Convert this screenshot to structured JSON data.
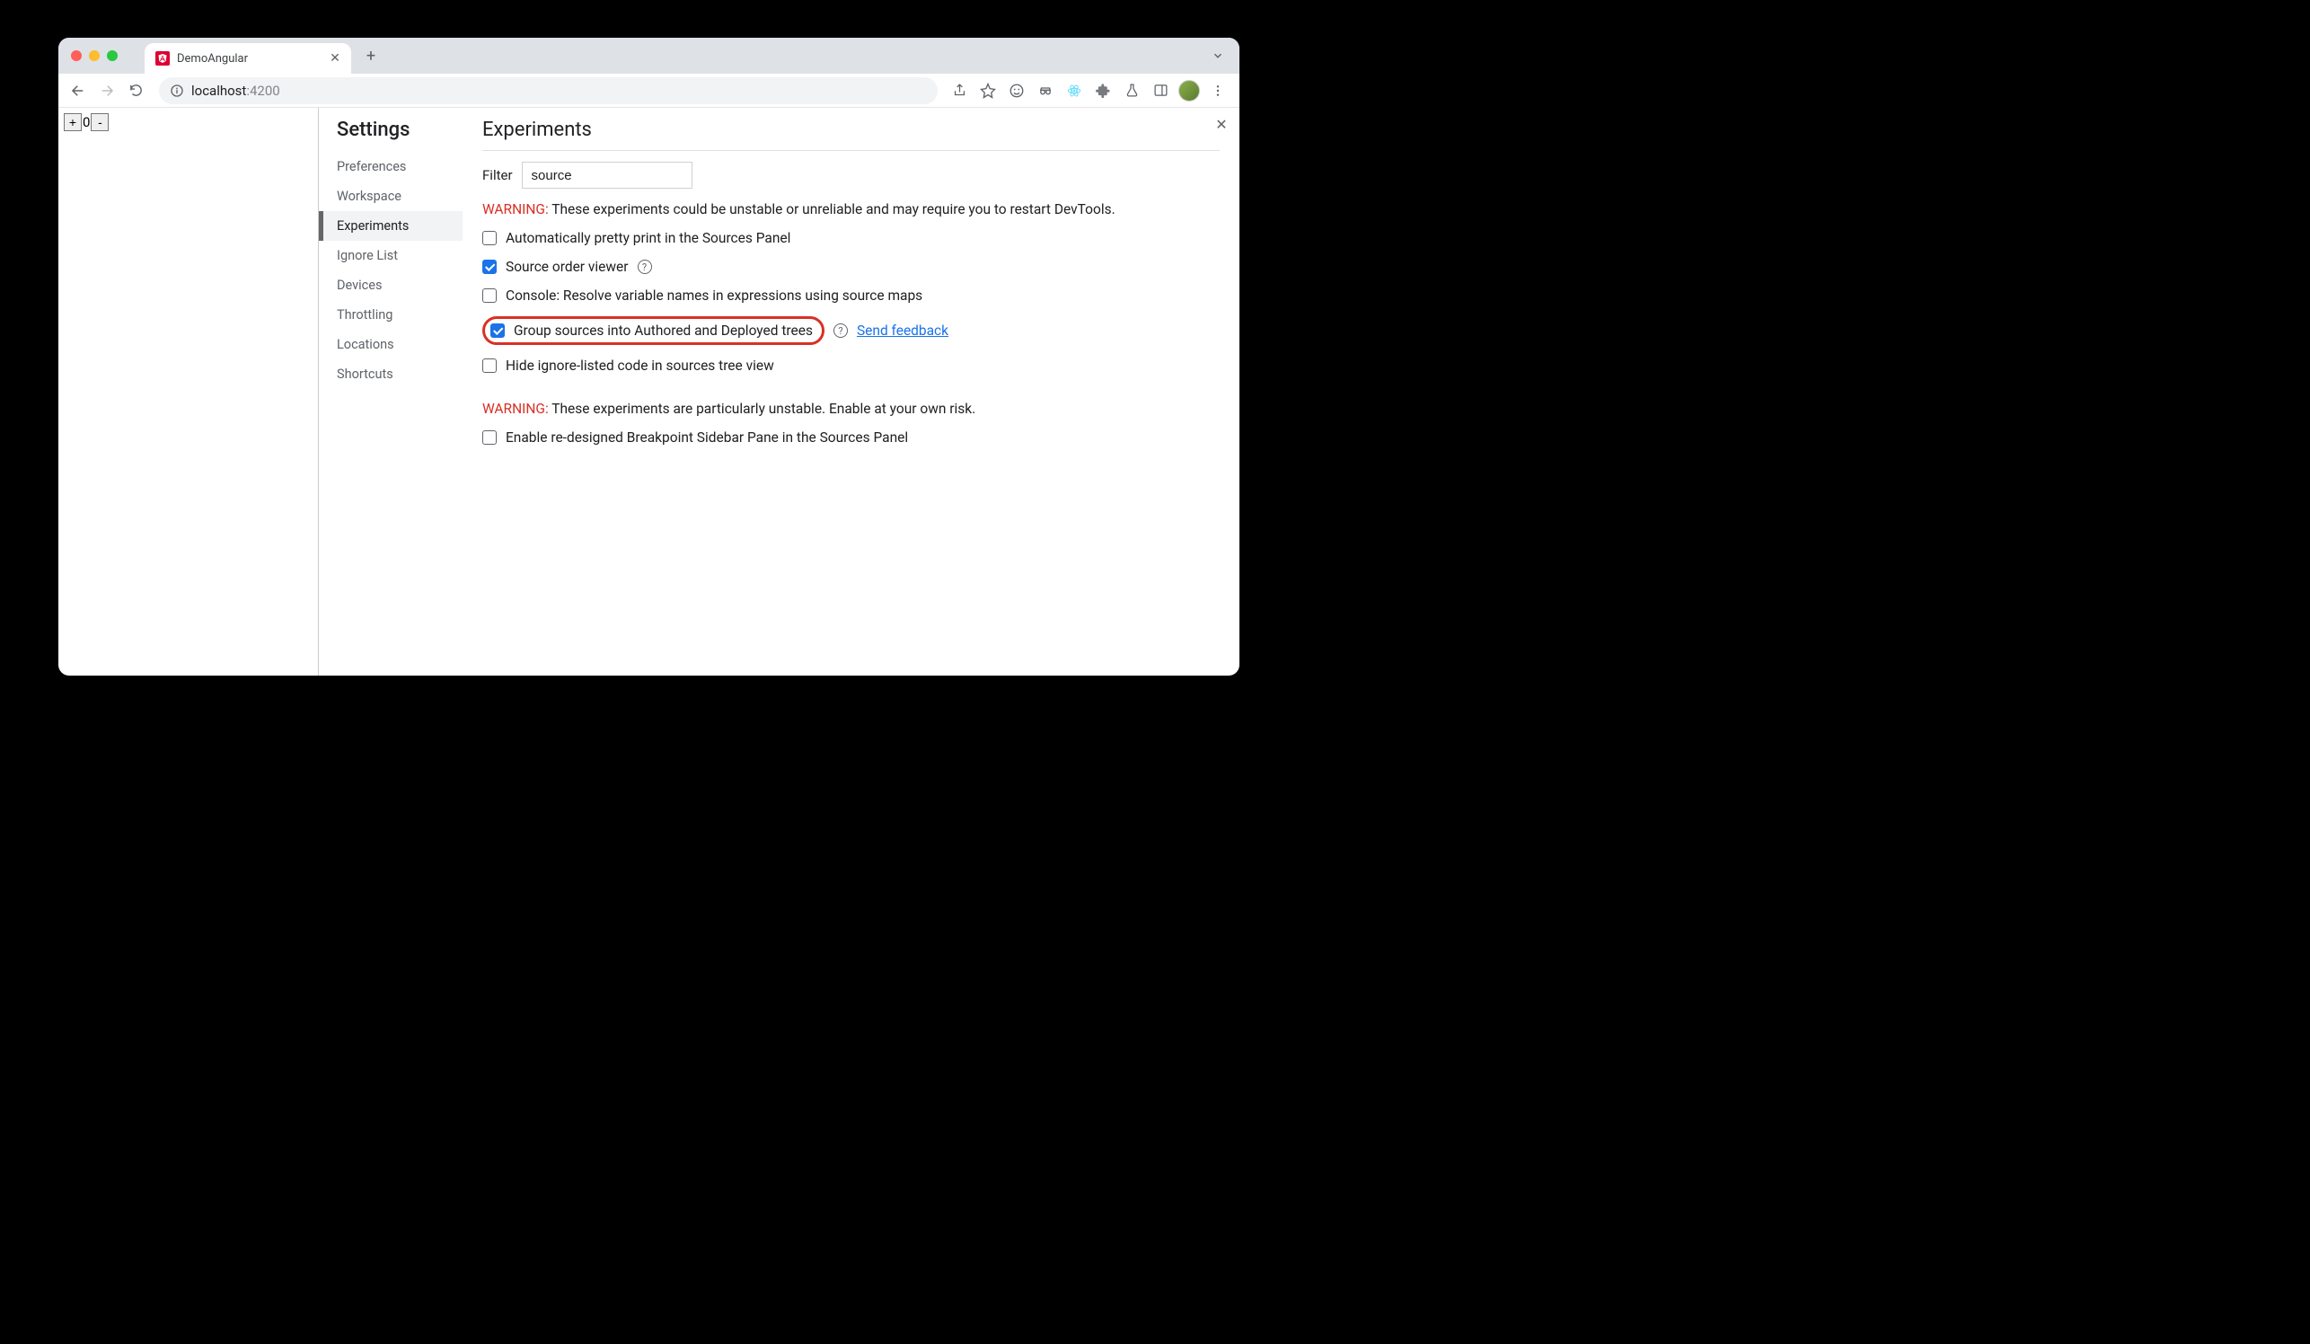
{
  "tab": {
    "title": "DemoAngular"
  },
  "url": {
    "host": "localhost",
    "port": ":4200"
  },
  "page": {
    "counter_value": "0",
    "plus": "+",
    "minus": "-"
  },
  "settings": {
    "title": "Settings",
    "nav": {
      "preferences": "Preferences",
      "workspace": "Workspace",
      "experiments": "Experiments",
      "ignorelist": "Ignore List",
      "devices": "Devices",
      "throttling": "Throttling",
      "locations": "Locations",
      "shortcuts": "Shortcuts"
    }
  },
  "experiments": {
    "title": "Experiments",
    "filter_label": "Filter",
    "filter_value": "source",
    "warning1_label": "WARNING:",
    "warning1_text": " These experiments could be unstable or unreliable and may require you to restart DevTools.",
    "warning2_label": "WARNING:",
    "warning2_text": " These experiments are particularly unstable. Enable at your own risk.",
    "items": {
      "pretty_print": "Automatically pretty print in the Sources Panel",
      "source_order": "Source order viewer",
      "console_resolve": "Console: Resolve variable names in expressions using source maps",
      "group_sources": "Group sources into Authored and Deployed trees",
      "hide_ignore": "Hide ignore-listed code in sources tree view",
      "breakpoint_sidebar": "Enable re-designed Breakpoint Sidebar Pane in the Sources Panel"
    },
    "feedback_link": "Send feedback",
    "help": "?"
  }
}
